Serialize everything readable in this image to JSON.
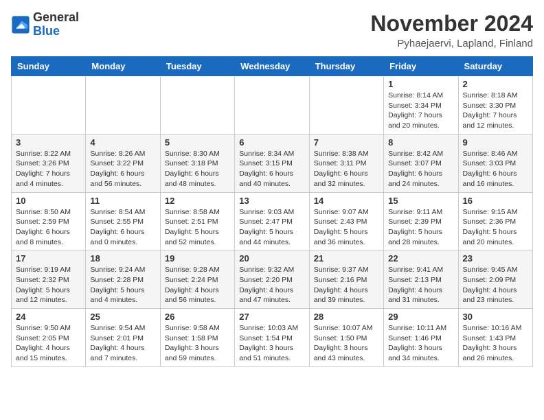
{
  "logo": {
    "general": "General",
    "blue": "Blue"
  },
  "header": {
    "month": "November 2024",
    "location": "Pyhaejaervi, Lapland, Finland"
  },
  "weekdays": [
    "Sunday",
    "Monday",
    "Tuesday",
    "Wednesday",
    "Thursday",
    "Friday",
    "Saturday"
  ],
  "weeks": [
    [
      {
        "day": "",
        "info": ""
      },
      {
        "day": "",
        "info": ""
      },
      {
        "day": "",
        "info": ""
      },
      {
        "day": "",
        "info": ""
      },
      {
        "day": "",
        "info": ""
      },
      {
        "day": "1",
        "info": "Sunrise: 8:14 AM\nSunset: 3:34 PM\nDaylight: 7 hours\nand 20 minutes."
      },
      {
        "day": "2",
        "info": "Sunrise: 8:18 AM\nSunset: 3:30 PM\nDaylight: 7 hours\nand 12 minutes."
      }
    ],
    [
      {
        "day": "3",
        "info": "Sunrise: 8:22 AM\nSunset: 3:26 PM\nDaylight: 7 hours\nand 4 minutes."
      },
      {
        "day": "4",
        "info": "Sunrise: 8:26 AM\nSunset: 3:22 PM\nDaylight: 6 hours\nand 56 minutes."
      },
      {
        "day": "5",
        "info": "Sunrise: 8:30 AM\nSunset: 3:18 PM\nDaylight: 6 hours\nand 48 minutes."
      },
      {
        "day": "6",
        "info": "Sunrise: 8:34 AM\nSunset: 3:15 PM\nDaylight: 6 hours\nand 40 minutes."
      },
      {
        "day": "7",
        "info": "Sunrise: 8:38 AM\nSunset: 3:11 PM\nDaylight: 6 hours\nand 32 minutes."
      },
      {
        "day": "8",
        "info": "Sunrise: 8:42 AM\nSunset: 3:07 PM\nDaylight: 6 hours\nand 24 minutes."
      },
      {
        "day": "9",
        "info": "Sunrise: 8:46 AM\nSunset: 3:03 PM\nDaylight: 6 hours\nand 16 minutes."
      }
    ],
    [
      {
        "day": "10",
        "info": "Sunrise: 8:50 AM\nSunset: 2:59 PM\nDaylight: 6 hours\nand 8 minutes."
      },
      {
        "day": "11",
        "info": "Sunrise: 8:54 AM\nSunset: 2:55 PM\nDaylight: 6 hours\nand 0 minutes."
      },
      {
        "day": "12",
        "info": "Sunrise: 8:58 AM\nSunset: 2:51 PM\nDaylight: 5 hours\nand 52 minutes."
      },
      {
        "day": "13",
        "info": "Sunrise: 9:03 AM\nSunset: 2:47 PM\nDaylight: 5 hours\nand 44 minutes."
      },
      {
        "day": "14",
        "info": "Sunrise: 9:07 AM\nSunset: 2:43 PM\nDaylight: 5 hours\nand 36 minutes."
      },
      {
        "day": "15",
        "info": "Sunrise: 9:11 AM\nSunset: 2:39 PM\nDaylight: 5 hours\nand 28 minutes."
      },
      {
        "day": "16",
        "info": "Sunrise: 9:15 AM\nSunset: 2:36 PM\nDaylight: 5 hours\nand 20 minutes."
      }
    ],
    [
      {
        "day": "17",
        "info": "Sunrise: 9:19 AM\nSunset: 2:32 PM\nDaylight: 5 hours\nand 12 minutes."
      },
      {
        "day": "18",
        "info": "Sunrise: 9:24 AM\nSunset: 2:28 PM\nDaylight: 5 hours\nand 4 minutes."
      },
      {
        "day": "19",
        "info": "Sunrise: 9:28 AM\nSunset: 2:24 PM\nDaylight: 4 hours\nand 56 minutes."
      },
      {
        "day": "20",
        "info": "Sunrise: 9:32 AM\nSunset: 2:20 PM\nDaylight: 4 hours\nand 47 minutes."
      },
      {
        "day": "21",
        "info": "Sunrise: 9:37 AM\nSunset: 2:16 PM\nDaylight: 4 hours\nand 39 minutes."
      },
      {
        "day": "22",
        "info": "Sunrise: 9:41 AM\nSunset: 2:13 PM\nDaylight: 4 hours\nand 31 minutes."
      },
      {
        "day": "23",
        "info": "Sunrise: 9:45 AM\nSunset: 2:09 PM\nDaylight: 4 hours\nand 23 minutes."
      }
    ],
    [
      {
        "day": "24",
        "info": "Sunrise: 9:50 AM\nSunset: 2:05 PM\nDaylight: 4 hours\nand 15 minutes."
      },
      {
        "day": "25",
        "info": "Sunrise: 9:54 AM\nSunset: 2:01 PM\nDaylight: 4 hours\nand 7 minutes."
      },
      {
        "day": "26",
        "info": "Sunrise: 9:58 AM\nSunset: 1:58 PM\nDaylight: 3 hours\nand 59 minutes."
      },
      {
        "day": "27",
        "info": "Sunrise: 10:03 AM\nSunset: 1:54 PM\nDaylight: 3 hours\nand 51 minutes."
      },
      {
        "day": "28",
        "info": "Sunrise: 10:07 AM\nSunset: 1:50 PM\nDaylight: 3 hours\nand 43 minutes."
      },
      {
        "day": "29",
        "info": "Sunrise: 10:11 AM\nSunset: 1:46 PM\nDaylight: 3 hours\nand 34 minutes."
      },
      {
        "day": "30",
        "info": "Sunrise: 10:16 AM\nSunset: 1:43 PM\nDaylight: 3 hours\nand 26 minutes."
      }
    ]
  ]
}
